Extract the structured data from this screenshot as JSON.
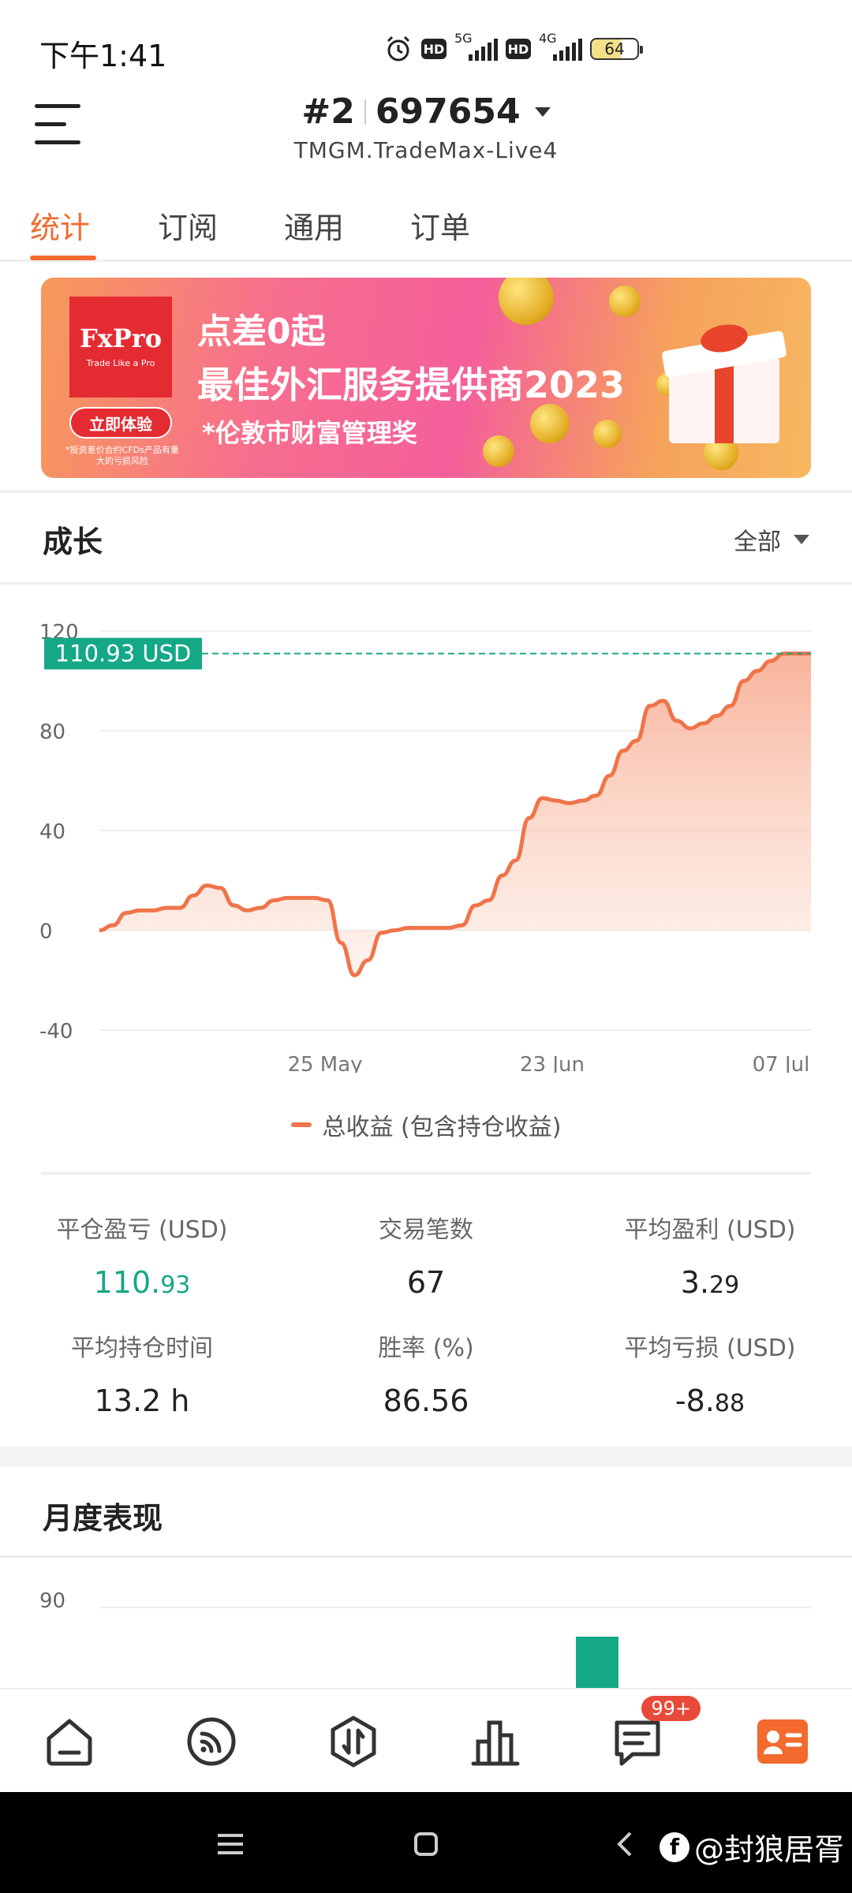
{
  "status_bar": {
    "time": "下午1:41",
    "network_1": "5G",
    "network_2": "4G",
    "battery": "64",
    "hd": "HD"
  },
  "header": {
    "account_no": "#2",
    "account_id": "697654",
    "server": "TMGM.TradeMax-Live4"
  },
  "tabs": [
    {
      "label": "统计",
      "active": true
    },
    {
      "label": "订阅",
      "active": false
    },
    {
      "label": "通用",
      "active": false
    },
    {
      "label": "订单",
      "active": false
    }
  ],
  "banner": {
    "logo": "FxPro",
    "logo_sub": "Trade Like a Pro",
    "cta": "立即体验",
    "disclaimer": "*投资差价合约CFDs产品有重大的亏损风险",
    "line1": "点差0起",
    "line2": "最佳外汇服务提供商2023",
    "line3": "*伦敦市财富管理奖"
  },
  "growth": {
    "title": "成长",
    "range": "全部",
    "legend": "总收益 (包含持仓收益)"
  },
  "chart_data": {
    "type": "area",
    "ylim": [
      -40,
      120
    ],
    "yticks": [
      "120",
      "80",
      "40",
      "0",
      "-40"
    ],
    "ytick_values": [
      120,
      80,
      40,
      0,
      -40
    ],
    "xticks": [
      "25 May",
      "23 Jun",
      "07 Jul"
    ],
    "current_label": "110.93 USD",
    "current_value": 110.93,
    "series": [
      {
        "name": "总收益 (包含持仓收益)",
        "color": "#f0744a",
        "values": [
          0,
          2,
          7,
          8,
          8,
          9,
          9,
          14,
          18,
          17,
          10,
          8,
          9,
          12,
          13,
          13,
          13,
          12,
          -5,
          -18,
          -12,
          -1,
          0,
          1,
          1,
          1,
          1,
          2,
          10,
          12,
          22,
          28,
          45,
          53,
          52,
          51,
          52,
          54,
          62,
          72,
          76,
          90,
          92,
          84,
          81,
          83,
          86,
          90,
          100,
          104,
          108,
          110.93,
          110.93,
          110.93
        ]
      }
    ]
  },
  "stats": [
    {
      "label": "平仓盈亏 (USD)",
      "value_int": "110.",
      "value_dec": "93",
      "color": "green"
    },
    {
      "label": "交易笔数",
      "value_int": "67",
      "value_dec": "",
      "color": "default"
    },
    {
      "label": "平均盈利 (USD)",
      "value_int": "3.",
      "value_dec": "29",
      "color": "default"
    },
    {
      "label": "平均持仓时间",
      "value_int": "13.2 h",
      "value_dec": "",
      "color": "default"
    },
    {
      "label": "胜率 (%)",
      "value_int": "86.56",
      "value_dec": "",
      "color": "default"
    },
    {
      "label": "平均亏损 (USD)",
      "value_int": "-8.",
      "value_dec": "88",
      "color": "default"
    }
  ],
  "monthly": {
    "title": "月度表现",
    "ytick_top": "90"
  },
  "bottom_nav": {
    "items": [
      "home-icon",
      "feed-icon",
      "trade-icon",
      "chart-icon",
      "message-icon",
      "profile-icon"
    ],
    "message_badge": "99+"
  },
  "system_nav": {
    "watermark": "@封狼居胥"
  },
  "colors": {
    "accent": "#f26a2e",
    "green": "#15a887",
    "line": "#f0744a"
  }
}
